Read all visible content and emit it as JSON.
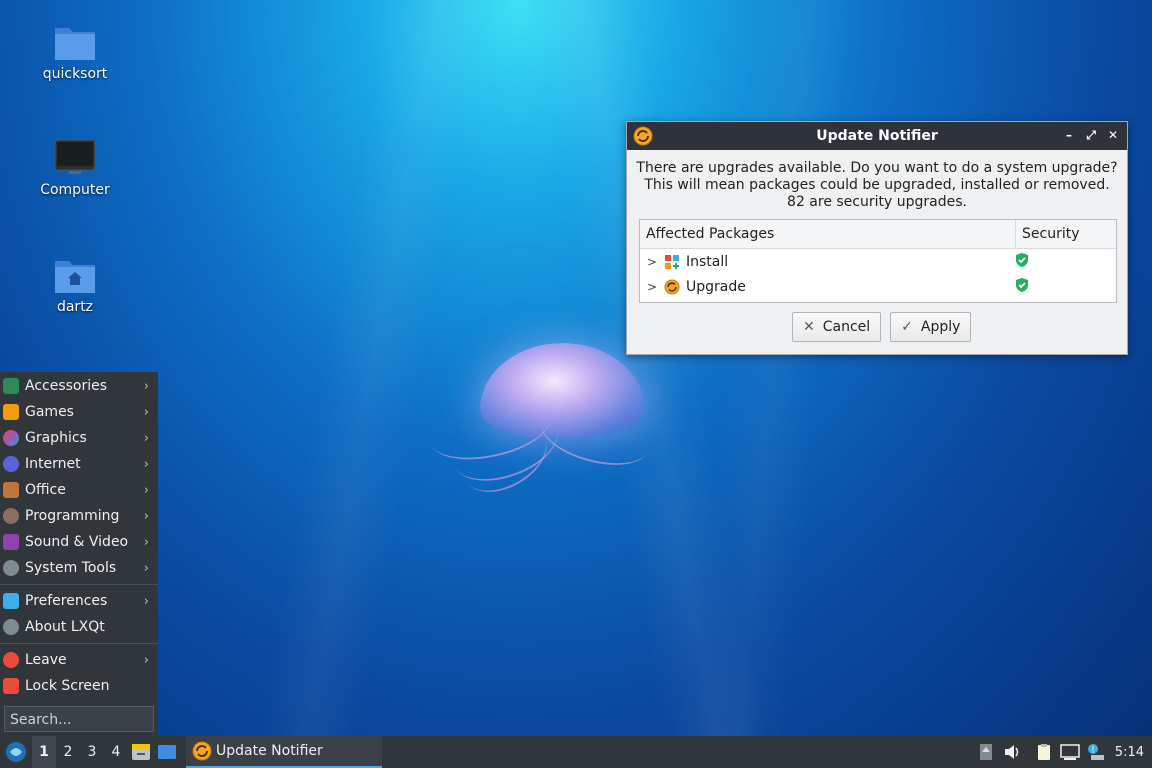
{
  "desktop": {
    "icons": [
      {
        "label": "quicksort"
      },
      {
        "label": "Computer"
      },
      {
        "label": "dartz"
      }
    ]
  },
  "dialog": {
    "title": "Update Notifier",
    "message_line1": "There are upgrades available. Do you want to do a system upgrade?",
    "message_line2": "This will mean packages could be upgraded, installed or removed.",
    "message_line3": "82 are security upgrades.",
    "columns": [
      "Affected Packages",
      "Security"
    ],
    "rows": [
      {
        "name": "Install",
        "security_icon": "shield-check-icon"
      },
      {
        "name": "Upgrade",
        "security_icon": "shield-check-icon"
      }
    ],
    "cancel_label": "Cancel",
    "apply_label": "Apply"
  },
  "menu": {
    "items": [
      {
        "label": "Accessories"
      },
      {
        "label": "Games"
      },
      {
        "label": "Graphics"
      },
      {
        "label": "Internet"
      },
      {
        "label": "Office"
      },
      {
        "label": "Programming"
      },
      {
        "label": "Sound & Video"
      },
      {
        "label": "System Tools"
      },
      {
        "label": "Preferences"
      },
      {
        "label": "About LXQt"
      },
      {
        "label": "Leave"
      },
      {
        "label": "Lock Screen"
      }
    ],
    "search_placeholder": "Search..."
  },
  "taskbar": {
    "desktops": [
      "1",
      "2",
      "3",
      "4"
    ],
    "active_desktop": "1",
    "task_label": "Update Notifier",
    "clock": "5:14"
  },
  "colors": {
    "panel": "#31363b",
    "accent": "#3daee9",
    "security_green": "#27ae60"
  }
}
